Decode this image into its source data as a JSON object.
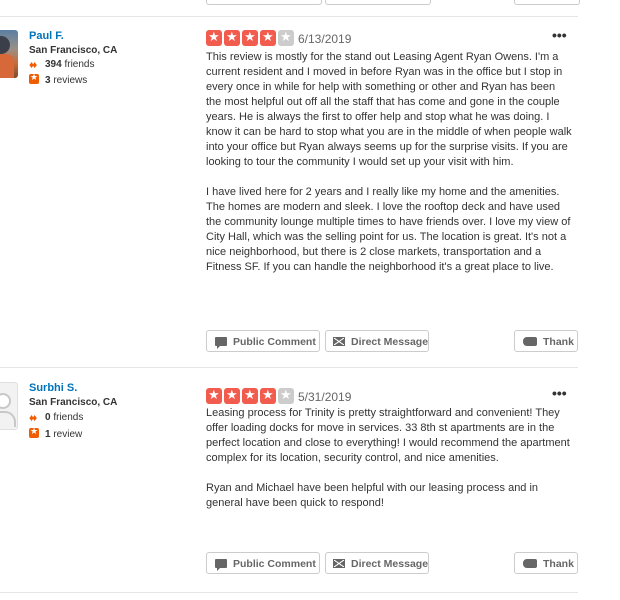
{
  "top_buttons": [
    "",
    "",
    ""
  ],
  "reviews": [
    {
      "user": {
        "name": "Paul F.",
        "location": "San Francisco, CA",
        "friends": "394",
        "friends_label": "friends",
        "reviews": "3",
        "reviews_label": "reviews",
        "avatar": "user-photo"
      },
      "rating": 4,
      "rating_max": 5,
      "date": "6/13/2019",
      "paragraphs": [
        "This review is mostly for the stand out Leasing Agent Ryan Owens.  I'm a current resident and I moved in before Ryan was in the office but I stop in every once in while for help with something or other and Ryan has been the most helpful out off all the staff that has come and gone in the couple years.  He is always the first to offer help and stop what he was doing.  I know it can be hard to stop what you are in the middle of when people walk into your office but Ryan always seems up for the surprise visits. If you are looking to tour the community I would set up your visit with him.",
        "I have lived here for 2 years and I really like my home and the amenities.  The homes are modern and sleek.  I love the rooftop deck and have used the community lounge multiple times to have friends over.  I love my view of City Hall, which was the selling point for us.  The location is great.  It's not a nice neighborhood, but there is 2 close markets, transportation and a Fitness SF.  If you can handle the neighborhood it's a great place to live."
      ]
    },
    {
      "user": {
        "name": "Surbhi S.",
        "location": "San Francisco, CA",
        "friends": "0",
        "friends_label": "friends",
        "reviews": "1",
        "reviews_label": "review",
        "avatar": "default-avatar"
      },
      "rating": 4,
      "rating_max": 5,
      "date": "5/31/2019",
      "paragraphs": [
        "Leasing process for Trinity is pretty straightforward and convenient! They offer loading docks for move in services. 33 8th st apartments are in the perfect location and close to everything! I would recommend the apartment complex for its location, security control, and nice amenities.",
        "Ryan and Michael have been helpful with our leasing process and in general have been quick to respond!"
      ]
    }
  ],
  "actions": {
    "public_comment": "Public Comment",
    "direct_message": "Direct Message",
    "thank": "Thank",
    "more": "•••"
  },
  "colors": {
    "accent": "#f15c4f",
    "link": "#0073bb",
    "star_off": "#cccccc",
    "social": "#f15c00"
  }
}
